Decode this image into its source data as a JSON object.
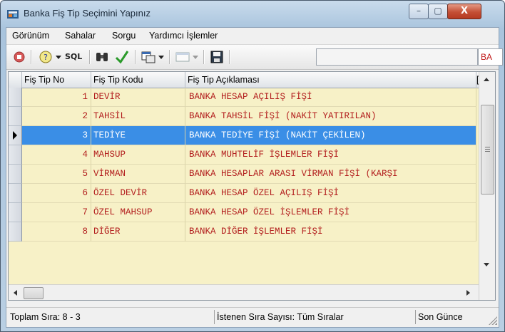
{
  "window": {
    "title": "Banka Fiş Tip Seçimini Yapınız"
  },
  "caption_buttons": {
    "minimize": "–",
    "maximize": "▢",
    "close": "X"
  },
  "menu": [
    {
      "label": "Görünüm"
    },
    {
      "label": "Sahalar"
    },
    {
      "label": "Sorgu"
    },
    {
      "label": "Yardımcı İşlemler"
    }
  ],
  "toolbar": {
    "sql_label": "SQL",
    "badge_text": "BA",
    "icons": [
      "stop-icon",
      "help-icon",
      "dropdown-arrow-icon",
      "sql-icon",
      "binoculars-icon",
      "checkmark-icon",
      "copy-icon",
      "window-icon",
      "save-icon"
    ]
  },
  "grid": {
    "columns": [
      "Fiş Tip No",
      "Fiş Tip Kodu",
      "Fiş Tip Açıklaması",
      "["
    ],
    "rows": [
      {
        "no": "1",
        "kod": "DEVİR",
        "aciklama": "BANKA HESAP AÇILIŞ FİŞİ"
      },
      {
        "no": "2",
        "kod": "TAHSİL",
        "aciklama": "BANKA TAHSİL FİŞİ (NAKİT YATIRILAN)"
      },
      {
        "no": "3",
        "kod": "TEDİYE",
        "aciklama": "BANKA TEDİYE FİŞİ (NAKİT ÇEKİLEN)"
      },
      {
        "no": "4",
        "kod": "MAHSUP",
        "aciklama": "BANKA MUHTELİF İŞLEMLER FİŞİ"
      },
      {
        "no": "5",
        "kod": "VİRMAN",
        "aciklama": "BANKA HESAPLAR ARASI VİRMAN FİŞİ (KARŞI"
      },
      {
        "no": "6",
        "kod": "ÖZEL DEVİR",
        "aciklama": "BANKA HESAP ÖZEL AÇILIŞ FİŞİ"
      },
      {
        "no": "7",
        "kod": "ÖZEL MAHSUP",
        "aciklama": "BANKA HESAP ÖZEL İŞLEMLER FİŞİ"
      },
      {
        "no": "8",
        "kod": "DİĞER",
        "aciklama": "BANKA DİĞER İŞLEMLER FİŞİ"
      }
    ],
    "selected_row_index": 2
  },
  "status": {
    "left": "Toplam Sıra: 8 - 3",
    "middle": "İstenen Sıra Sayısı: Tüm Sıralar",
    "right": "Son Günce"
  },
  "colors": {
    "grid_background": "#f7f1c7",
    "cell_text": "#b21d1d",
    "selection": "#3a8ee6"
  }
}
